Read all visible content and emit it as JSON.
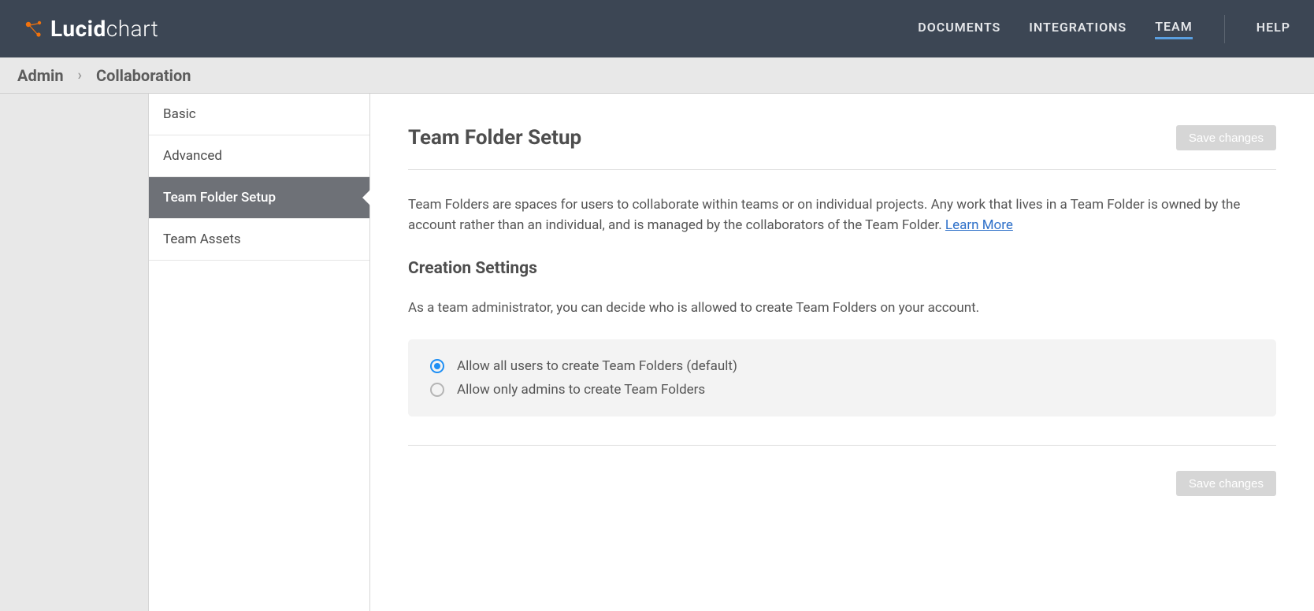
{
  "logo": {
    "bold": "Lucid",
    "light": "chart"
  },
  "nav": {
    "items": [
      {
        "label": "DOCUMENTS"
      },
      {
        "label": "INTEGRATIONS"
      },
      {
        "label": "TEAM"
      },
      {
        "label": "HELP"
      }
    ]
  },
  "breadcrumb": {
    "admin": "Admin",
    "current": "Collaboration"
  },
  "sidebar": {
    "items": [
      {
        "label": "Basic"
      },
      {
        "label": "Advanced"
      },
      {
        "label": "Team Folder Setup"
      },
      {
        "label": "Team Assets"
      }
    ]
  },
  "main": {
    "title": "Team Folder Setup",
    "save_label": "Save changes",
    "description": "Team Folders are spaces for users to collaborate within teams or on individual projects. Any work that lives in a Team Folder is owned by the account rather than an individual, and is managed by the collaborators of the Team Folder. ",
    "learn_more": "Learn More",
    "section_title": "Creation Settings",
    "section_desc": "As a team administrator, you can decide who is allowed to create Team Folders on your account.",
    "radios": [
      {
        "label": "Allow all users to create Team Folders (default)",
        "checked": true
      },
      {
        "label": "Allow only admins to create Team Folders",
        "checked": false
      }
    ]
  }
}
